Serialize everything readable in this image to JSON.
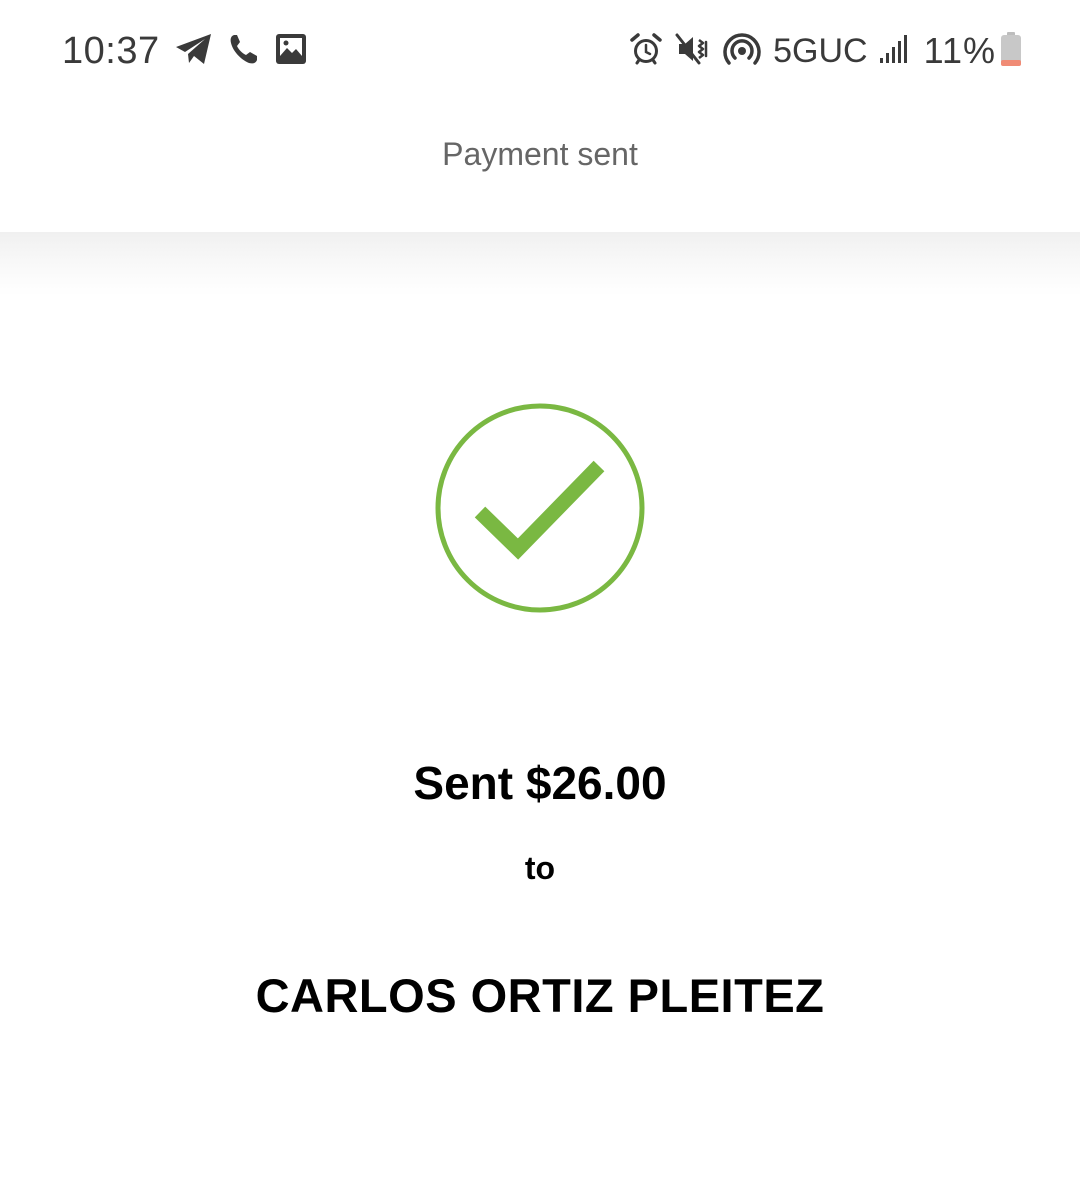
{
  "status_bar": {
    "time": "10:37",
    "left_icons": [
      "telegram-icon",
      "phone-call-icon",
      "gallery-icon"
    ],
    "right_icons": [
      "alarm-icon",
      "vibrate-mute-icon",
      "hotspot-icon",
      "signal-bars-icon",
      "battery-low-icon"
    ],
    "network": "5GUC",
    "battery": "11%",
    "battery_level": 0.11,
    "colors": {
      "icon": "#3a3a3a",
      "battery_low": "#f08b75"
    }
  },
  "header": {
    "title": "Payment sent"
  },
  "confirmation": {
    "icon": "check-circle-icon",
    "accent_color": "#7ab842",
    "amount_text": "Sent $26.00",
    "to_text": "to",
    "recipient": "CARLOS ORTIZ PLEITEZ"
  }
}
